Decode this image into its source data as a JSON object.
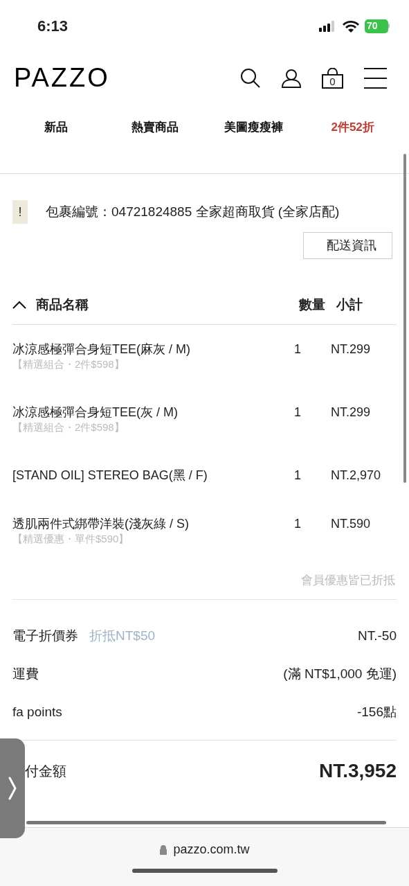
{
  "status_bar": {
    "time": "6:13",
    "battery": "70"
  },
  "header": {
    "logo": "PAZZO",
    "cart_count": "0"
  },
  "nav": [
    {
      "label": "新品",
      "highlight": false
    },
    {
      "label": "熱賣商品",
      "highlight": false
    },
    {
      "label": "美圖瘦瘦褲",
      "highlight": false
    },
    {
      "label": "2件52折",
      "highlight": true
    }
  ],
  "package": {
    "alert_icon": "!",
    "text": "包裹編號：04721824885 全家超商取貨 (全家店配)",
    "button": "配送資訊"
  },
  "table": {
    "expanded": true,
    "columns": [
      "商品名稱",
      "數量",
      "小計"
    ],
    "rows": [
      {
        "name": "冰涼感極彈合身短TEE(麻灰 / M)",
        "promo": "【精選組合・2件$598】",
        "qty": "1",
        "subtotal": "NT.299"
      },
      {
        "name": "冰涼感極彈合身短TEE(灰 / M)",
        "promo": "【精選組合・2件$598】",
        "qty": "1",
        "subtotal": "NT.299"
      },
      {
        "name": "[STAND OIL] STEREO BAG(黑 / F)",
        "qty": "1",
        "subtotal": "NT.2,970"
      },
      {
        "name": "透肌兩件式綁帶洋裝(淺灰綠 / S)",
        "promo": "【精選優惠・單件$590】",
        "qty": "1",
        "subtotal": "NT.590"
      }
    ]
  },
  "member_note": "會員優惠皆已折抵",
  "summary": [
    {
      "label": "電子折價券",
      "note": "折抵NT$50",
      "value": "NT.-50"
    },
    {
      "label": "運費",
      "value": "(滿 NT$1,000 免運)"
    },
    {
      "label": "fa points",
      "value": "-156點"
    }
  ],
  "total": {
    "label": "付金額",
    "value": "NT.3,952"
  },
  "address_bar": {
    "url": "pazzo.com.tw"
  }
}
